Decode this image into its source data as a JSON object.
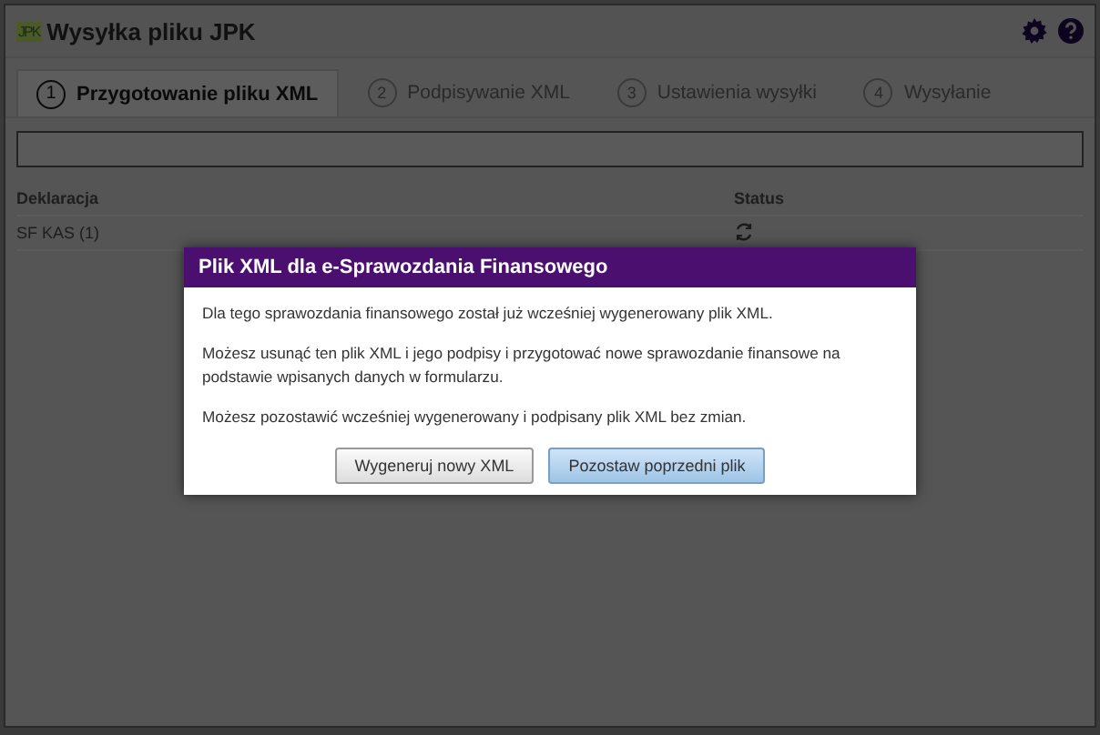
{
  "window": {
    "title": "Wysyłka pliku JPK",
    "logo": "JPK"
  },
  "tabs": [
    {
      "number": "1",
      "label": "Przygotowanie pliku XML",
      "selected": true
    },
    {
      "number": "2",
      "label": "Podpisywanie XML",
      "selected": false
    },
    {
      "number": "3",
      "label": "Ustawienia wysyłki",
      "selected": false
    },
    {
      "number": "4",
      "label": "Wysyłanie",
      "selected": false
    }
  ],
  "table": {
    "columns": [
      "Deklaracja",
      "Status"
    ],
    "rows": [
      {
        "name": "SF KAS (1)"
      }
    ]
  },
  "dialog": {
    "title": "Plik XML dla e-Sprawozdania Finansowego",
    "paragraphs": [
      "Dla tego sprawozdania finansowego został już wcześniej wygenerowany plik XML.",
      "Możesz usunąć ten plik XML i jego podpisy i przygotować nowe sprawozdanie finansowe na podstawie wpisanych danych w formularzu.",
      "Możesz pozostawić wcześniej wygenerowany i podpisany plik XML bez zmian."
    ],
    "buttons": [
      {
        "label": "Wygeneruj nowy XML",
        "primary": false
      },
      {
        "label": "Pozostaw poprzedni plik",
        "primary": true
      }
    ]
  }
}
